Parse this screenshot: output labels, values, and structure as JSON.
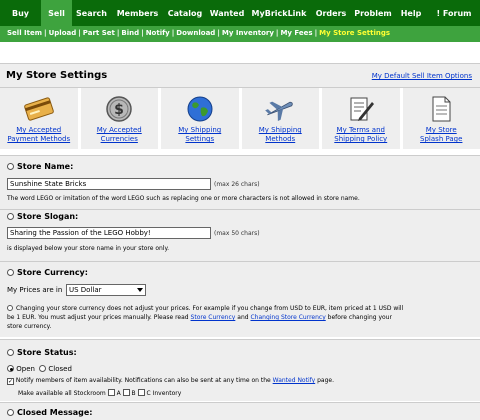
{
  "top_nav": [
    "Buy",
    "Sell",
    "Search",
    "Members",
    "Catalog",
    "Wanted",
    "MyBrickLink",
    "Orders",
    "Problem",
    "Help",
    "! Forum"
  ],
  "sub_nav": [
    "Sell Item",
    "Upload",
    "Part Set",
    "Bind",
    "Notify",
    "Download",
    "My Inventory",
    "My Fees",
    "My Store Settings"
  ],
  "header": {
    "title": "My Store Settings",
    "default_link": "My Default Sell Item Options"
  },
  "icons": [
    {
      "line1": "My Accepted",
      "line2": "Payment Methods",
      "icon": "payment-card-icon"
    },
    {
      "line1": "My Accepted",
      "line2": "Currencies",
      "icon": "currency-coin-icon"
    },
    {
      "line1": "My Shipping",
      "line2": "Settings",
      "icon": "globe-icon"
    },
    {
      "line1": "My Shipping",
      "line2": "Methods",
      "icon": "airplane-icon"
    },
    {
      "line1": "My Terms and",
      "line2": "Shipping Policy",
      "icon": "policy-document-icon"
    },
    {
      "line1": "My Store",
      "line2": "Splash Page",
      "icon": "splash-page-icon"
    }
  ],
  "store_name": {
    "label": "Store Name:",
    "value": "Sunshine State Bricks",
    "limit": "(max 26 chars)",
    "note": "The word LEGO or imitation of the word LEGO such as replacing one or more characters is not allowed in store name."
  },
  "store_slogan": {
    "label": "Store Slogan:",
    "value": "Sharing the Passion of the LEGO Hobby!",
    "limit": "(max 50 chars)",
    "note": "is displayed below your store name in your store only."
  },
  "store_currency": {
    "label": "Store Currency:",
    "prices_label": "My Prices are in",
    "selected": "US Dollar",
    "note_line1": "Changing your store currency does not adjust your prices. For example if you change from USD to EUR, item priced at 1 USD will",
    "note_line2_a": "be 1 EUR. You must adjust your prices manually. Please read",
    "note_link1": "Store Currency",
    "note_and": "and",
    "note_link2": "Changing Store Currency",
    "note_line2_b": "before changing your",
    "note_line3": "store currency."
  },
  "store_status": {
    "label": "Store Status:",
    "open": "Open",
    "closed": "Closed",
    "notify_a": "Notify members of item availability. Notifications can also be sent at any time on the",
    "notify_link": "Wanted Notify",
    "notify_b": "page.",
    "make_available": "Make available all Stockroom",
    "opt_a": "A",
    "opt_b": "B",
    "opt_c": "C Inventory"
  },
  "closed_message": {
    "label": "Closed Message:"
  },
  "colors": {
    "nav_bg": "#0a6b0a",
    "nav_active": "#3ea33e",
    "sub_current": "#ffff33",
    "link": "#0033cc",
    "panel": "#eeeeee"
  }
}
